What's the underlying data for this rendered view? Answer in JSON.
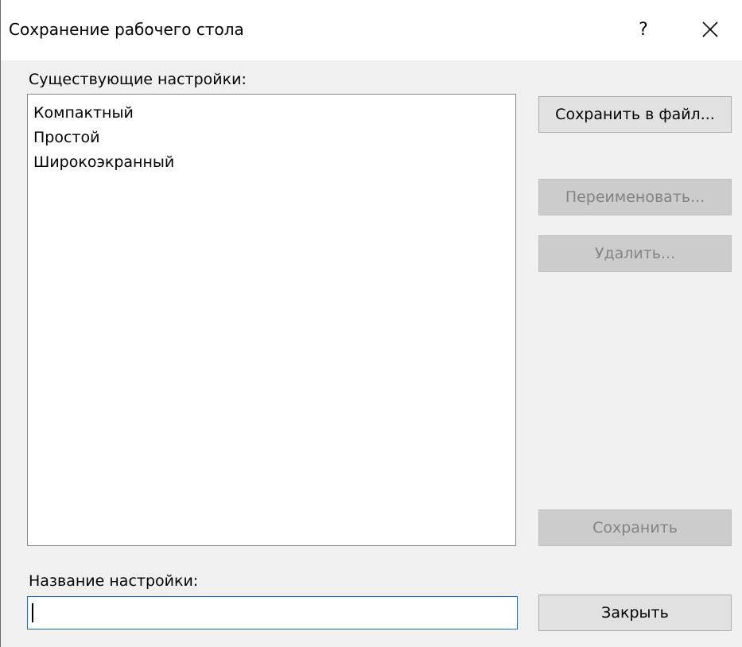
{
  "dialog": {
    "title": "Сохранение рабочего стола",
    "help_label": "?"
  },
  "settings_list": {
    "label": "Существующие настройки:",
    "items": [
      {
        "label": "Компактный"
      },
      {
        "label": "Простой"
      },
      {
        "label": "Широкоэкранный"
      }
    ]
  },
  "buttons": {
    "save_to_file": "Сохранить в файл...",
    "rename": "Переименовать...",
    "delete": "Удалить...",
    "save": "Сохранить",
    "close": "Закрыть"
  },
  "name_field": {
    "label": "Название настройки:",
    "value": ""
  },
  "icons": {
    "close": "close-icon"
  },
  "colors": {
    "accent": "#0078d7",
    "disabled_text": "#838383"
  }
}
